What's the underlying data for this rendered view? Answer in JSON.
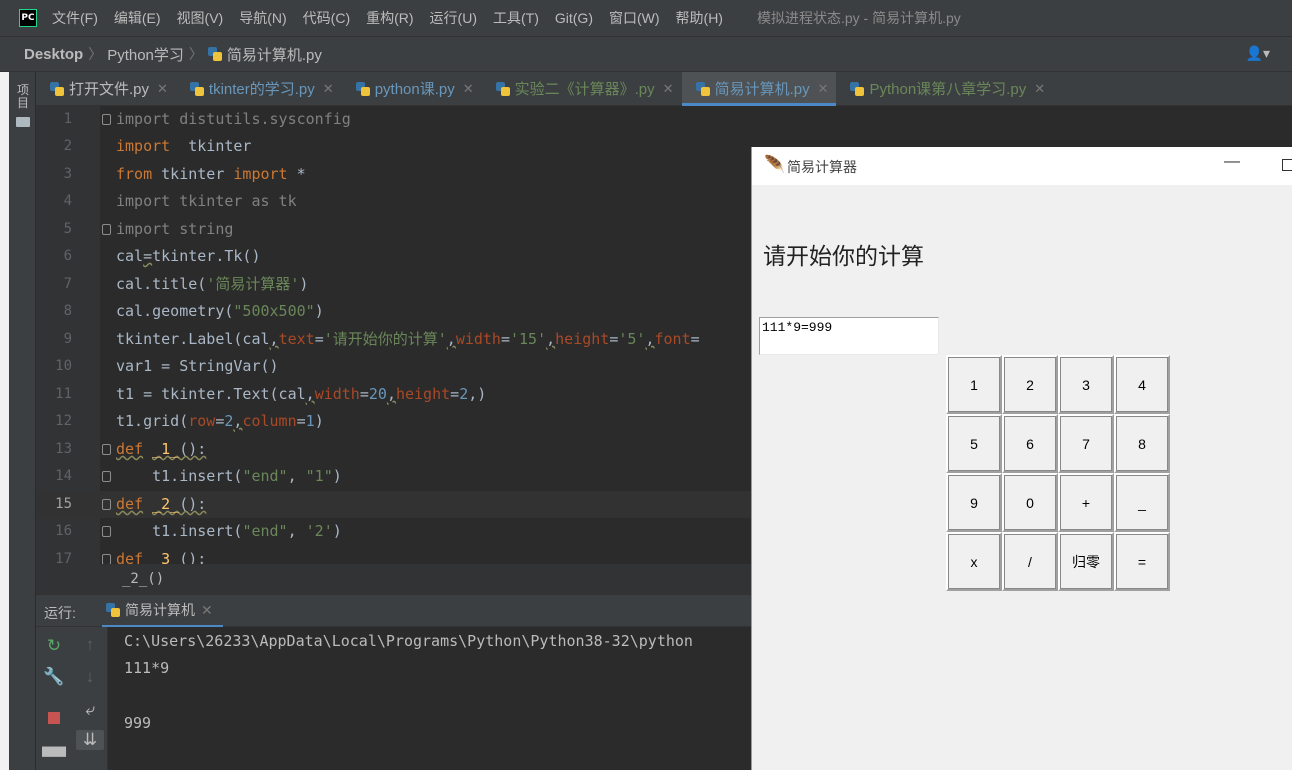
{
  "menubar": {
    "logo": "PC",
    "items": [
      "文件(F)",
      "编辑(E)",
      "视图(V)",
      "导航(N)",
      "代码(C)",
      "重构(R)",
      "运行(U)",
      "工具(T)",
      "Git(G)",
      "窗口(W)",
      "帮助(H)"
    ],
    "window_title": "模拟进程状态.py - 简易计算机.py"
  },
  "navbar": {
    "crumbs": [
      "Desktop",
      "Python学习",
      "简易计算机.py"
    ],
    "user_icon": "user-icon"
  },
  "sidebar": {
    "project_label": "项目"
  },
  "tabs": [
    {
      "label": "打开文件.py",
      "color": "#bbbbbb"
    },
    {
      "label": "tkinter的学习.py",
      "color": "#6897bb"
    },
    {
      "label": "python课.py",
      "color": "#6897bb"
    },
    {
      "label": "实验二《计算器》.py",
      "color": "#6a8759"
    },
    {
      "label": "简易计算机.py",
      "color": "#6897bb",
      "active": true
    },
    {
      "label": "Python课第八章学习.py",
      "color": "#6a8759"
    }
  ],
  "editor": {
    "line_numbers": [
      "1",
      "2",
      "3",
      "4",
      "5",
      "6",
      "7",
      "8",
      "9",
      "10",
      "11",
      "12",
      "13",
      "14",
      "15",
      "16",
      "17"
    ],
    "current_line": 15,
    "bottom_breadcrumb": "_2_()"
  },
  "run_panel": {
    "label": "运行:",
    "tab_label": "简易计算机",
    "console_lines": [
      "C:\\Users\\26233\\AppData\\Local\\Programs\\Python\\Python38-32\\python",
      "111*9",
      "",
      "999"
    ]
  },
  "tk_window": {
    "title": "简易计算器",
    "label": "请开始你的计算",
    "text_value": "111*9=999",
    "buttons": [
      "1",
      "2",
      "3",
      "4",
      "5",
      "6",
      "7",
      "8",
      "9",
      "0",
      "+",
      "_",
      "x",
      "/",
      "归零",
      "="
    ]
  },
  "colors": {
    "accent": "#4a88c7",
    "keyword": "#cc7832",
    "string": "#6a8759",
    "number": "#6897bb",
    "param": "#aa4926",
    "comment_gray": "#808080"
  }
}
